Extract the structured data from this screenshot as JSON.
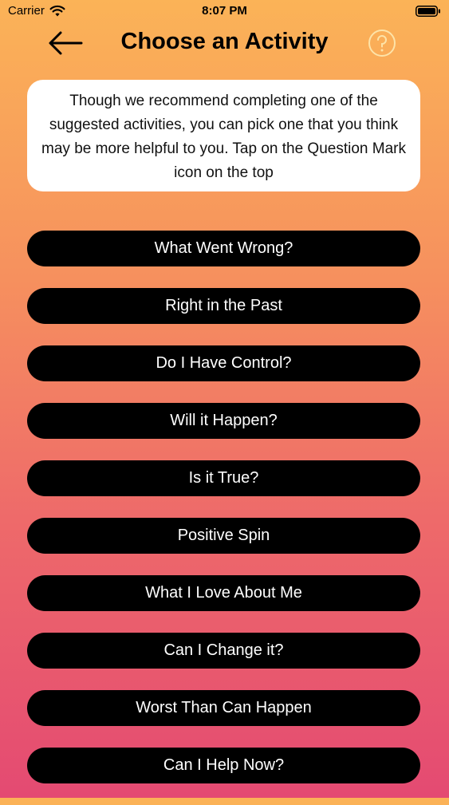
{
  "status_bar": {
    "carrier": "Carrier",
    "time": "8:07 PM"
  },
  "header": {
    "title": "Choose an Activity",
    "back_icon": "arrow-left-icon",
    "help_icon": "question-circle-icon",
    "help_icon_color": "#fde3a8"
  },
  "info": {
    "text": "Though we recommend completing one of the suggested activities, you can pick one that you think may be more helpful to you. Tap on the Question Mark icon on the top"
  },
  "activities": [
    "What Went Wrong?",
    "Right in the Past",
    "Do I Have Control?",
    "Will it Happen?",
    "Is it True?",
    "Positive Spin",
    "What I Love About Me",
    "Can I Change it?",
    "Worst Than Can Happen",
    "Can I Help Now?"
  ],
  "colors": {
    "gradient_top": "#fbb357",
    "gradient_bottom": "#e44a72",
    "button_bg": "#000000",
    "button_text": "#ffffff"
  }
}
